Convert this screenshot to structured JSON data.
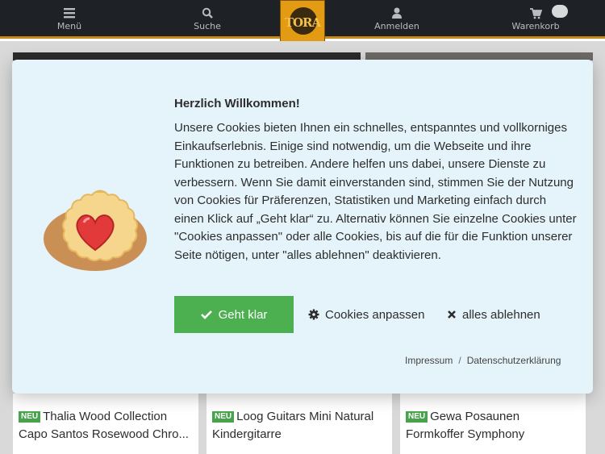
{
  "nav": {
    "menu_label": "Menü",
    "search_label": "Suche",
    "login_label": "Anmelden",
    "cart_label": "Warenkorb",
    "logo_text": "TORA"
  },
  "products": [
    {
      "badge": "NEU",
      "line1": "Thalia Wood Collection",
      "line2": "Capo Santos Rosewood Chro..."
    },
    {
      "badge": "NEU",
      "line1": "Loog Guitars Mini Natural",
      "line2": "Kindergitarre"
    },
    {
      "badge": "NEU",
      "line1": "Gewa Posaunen",
      "line2": "Formkoffer Symphony"
    }
  ],
  "cookie_modal": {
    "title": "Herzlich Willkommen!",
    "body": "Unsere Cookies bieten Ihnen ein schnelles, entspanntes und vollkorniges Einkaufserlebnis. Einige sind notwendig, um die Webseite und ihre Funktionen zu betreiben. Andere helfen uns dabei, unsere Dienste zu verbessern. Wenn Sie damit einverstanden sind, stimmen Sie der Nutzung von Cookies für Präferenzen, Statistiken und Marketing einfach durch einen Klick auf „Geht klar“ zu. Alternativ können Sie einzelne Cookies unter \"Cookies anpassen\" oder alle Cookies, bis auf die für die Funktion unserer Seite nötigen, unter \"alles ablehnen\" deaktivieren.",
    "accept_label": "Geht klar",
    "customize_label": "Cookies anpassen",
    "reject_label": "alles ablehnen",
    "imprint_label": "Impressum",
    "link_separator": "/",
    "privacy_label": "Datenschutzerklärung"
  },
  "icons": {
    "menu": "hamburger-icon",
    "search": "search-icon",
    "login": "user-icon",
    "cart": "cart-icon",
    "accept": "check-icon",
    "customize": "gear-icon",
    "reject": "close-icon",
    "cookie": "cookie-image"
  },
  "colors": {
    "nav_bg": "#1e2226",
    "nav_accent": "#c58a17",
    "modal_bg": "#e5f4fb",
    "accept_bg": "#4caf50",
    "badge_bg": "#49a34d"
  }
}
